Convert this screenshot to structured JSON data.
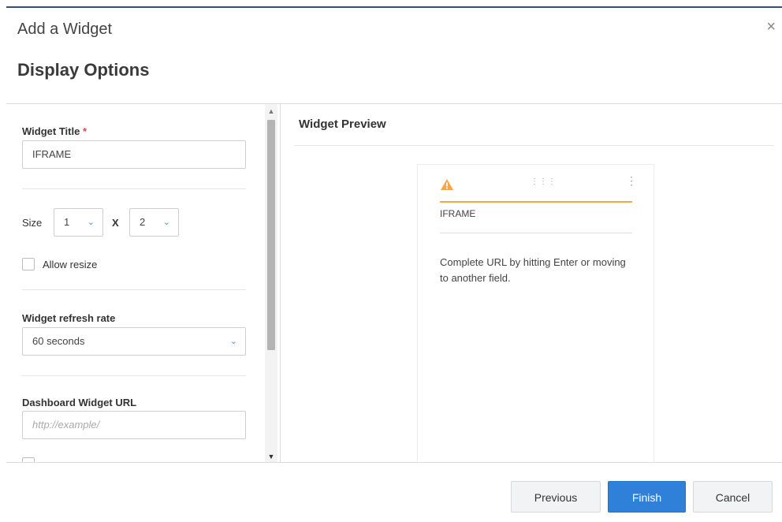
{
  "dialog": {
    "title": "Add a Widget",
    "section_title": "Display Options",
    "close_glyph": "×"
  },
  "form": {
    "widget_title": {
      "label": "Widget Title",
      "required_mark": "*",
      "value": "IFRAME"
    },
    "size": {
      "label": "Size",
      "width_value": "1",
      "separator": "X",
      "height_value": "2"
    },
    "allow_resize": {
      "label": "Allow resize",
      "checked": false
    },
    "refresh_rate": {
      "label": "Widget refresh rate",
      "value": "60 seconds"
    },
    "url": {
      "label": "Dashboard Widget URL",
      "placeholder": "http://example/"
    }
  },
  "preview": {
    "title": "Widget Preview",
    "card_title": "IFRAME",
    "message": "Complete URL by hitting Enter or moving to another field.",
    "warning_color": "#f5a54a"
  },
  "footer": {
    "previous_label": "Previous",
    "finish_label": "Finish",
    "cancel_label": "Cancel"
  },
  "colors": {
    "primary": "#2f80d8",
    "accent_orange": "#f5a54a",
    "required": "#e0454a"
  }
}
